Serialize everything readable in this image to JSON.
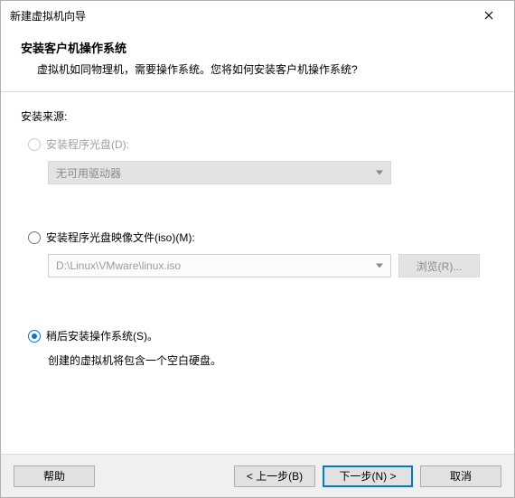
{
  "window": {
    "title": "新建虚拟机向导"
  },
  "header": {
    "title": "安装客户机操作系统",
    "desc": "虚拟机如同物理机，需要操作系统。您将如何安装客户机操作系统?"
  },
  "content": {
    "source_label": "安装来源:",
    "opt_disc": {
      "label": "安装程序光盘(D):",
      "combo": "无可用驱动器"
    },
    "opt_iso": {
      "label": "安装程序光盘映像文件(iso)(M):",
      "path": "D:\\Linux\\VMware\\linux.iso",
      "browse": "浏览(R)..."
    },
    "opt_later": {
      "label": "稍后安装操作系统(S)。",
      "note": "创建的虚拟机将包含一个空白硬盘。"
    }
  },
  "footer": {
    "help": "帮助",
    "back": "< 上一步(B)",
    "next": "下一步(N) >",
    "cancel": "取消"
  }
}
